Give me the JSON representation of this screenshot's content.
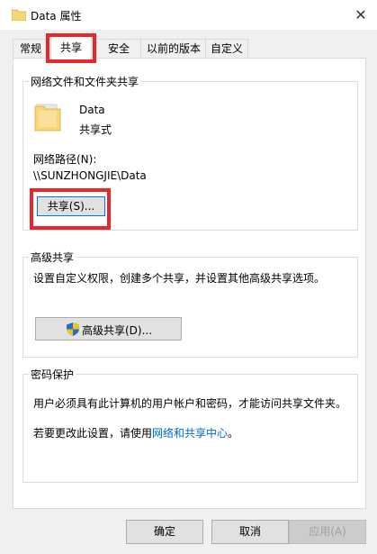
{
  "window": {
    "title": "Data 属性",
    "close_glyph": "✕"
  },
  "tabs": [
    {
      "label": "常规"
    },
    {
      "label": "共享"
    },
    {
      "label": "安全"
    },
    {
      "label": "以前的版本"
    },
    {
      "label": "自定义"
    }
  ],
  "network_share": {
    "group_title": "网络文件和文件夹共享",
    "folder_name": "Data",
    "folder_status": "共享式",
    "path_label": "网络路径(N):",
    "path_value": "\\\\SUNZHONGJIE\\Data",
    "share_button": "共享(S)..."
  },
  "advanced_share": {
    "group_title": "高级共享",
    "description": "设置自定义权限，创建多个共享，并设置其他高级共享选项。",
    "button": "高级共享(D)..."
  },
  "password": {
    "group_title": "密码保护",
    "description": "用户必须具有此计算机的用户帐户和密码，才能访问共享文件夹。",
    "change_prefix": "若要更改此设置，请使用",
    "link_text": "网络和共享中心",
    "change_suffix": "。"
  },
  "footer": {
    "ok": "确定",
    "cancel": "取消",
    "apply": "应用(A)"
  },
  "colors": {
    "highlight_box": "#e8272d",
    "link": "#0066cc",
    "folder": "#f7d674"
  }
}
